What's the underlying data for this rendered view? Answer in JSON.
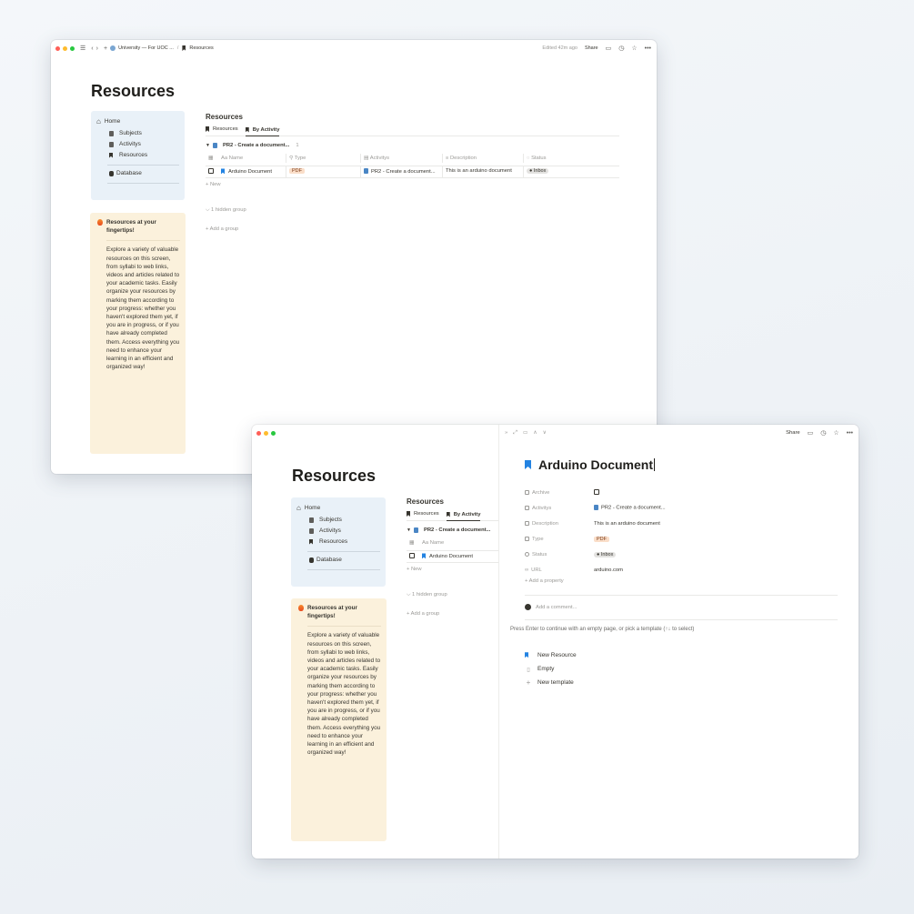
{
  "colors": {
    "accent": "#2383e2",
    "callout_bg": "#fbf1dc",
    "nav_bg": "#e9f1f8",
    "pdf_tag": "#fadec9",
    "inbox_tag": "#e3e2e0"
  },
  "window1": {
    "breadcrumb": {
      "workspace": "University — For UOC ...",
      "separator": "/",
      "page": "Resources"
    },
    "edited": "Edited 42m ago",
    "share": "Share"
  },
  "window2": {
    "share": "Share"
  },
  "page": {
    "title": "Resources",
    "nav": {
      "home": "Home",
      "items": [
        "Subjects",
        "Activitys",
        "Resources"
      ],
      "database": "Database"
    },
    "callout": {
      "title": "Resources at your fingertips!",
      "body": "Explore a variety of valuable resources on this screen, from syllabi to web links, videos and articles related to your academic tasks. Easily organize your resources by marking them according to your progress: whether you haven't explored them yet, if you are in progress, or if you have already completed them. Access everything you need to enhance your learning in an efficient and organized way!"
    },
    "database": {
      "title": "Resources",
      "tabs": [
        "Resources",
        "By Activity"
      ],
      "group": {
        "name": "PR2 - Create a document...",
        "count": "1"
      },
      "columns": [
        "Aa Name",
        "Type",
        "Activitys",
        "Description",
        "Status"
      ],
      "rows": [
        {
          "name": "Arduino Document",
          "type": "PDF",
          "activity": "PR2 - Create a document...",
          "description": "This is an arduino document",
          "status": "Inbox"
        }
      ],
      "new_label": "+ New",
      "hidden_group": "1 hidden group",
      "add_group": "+ Add a group"
    }
  },
  "peek": {
    "title": "Arduino Document",
    "properties": [
      {
        "key": "Archive",
        "value": ""
      },
      {
        "key": "Activitys",
        "value": "PR2 - Create a document..."
      },
      {
        "key": "Description",
        "value": "This is an arduino document"
      },
      {
        "key": "Type",
        "value": "PDF"
      },
      {
        "key": "Status",
        "value": "Inbox"
      },
      {
        "key": "URL",
        "value": "arduino.com"
      }
    ],
    "add_property": "+ Add a property",
    "comment_placeholder": "Add a comment...",
    "hint": "Press Enter to continue with an empty page, or pick a template (↑↓ to select)",
    "templates": [
      "New Resource",
      "Empty",
      "New template"
    ]
  }
}
